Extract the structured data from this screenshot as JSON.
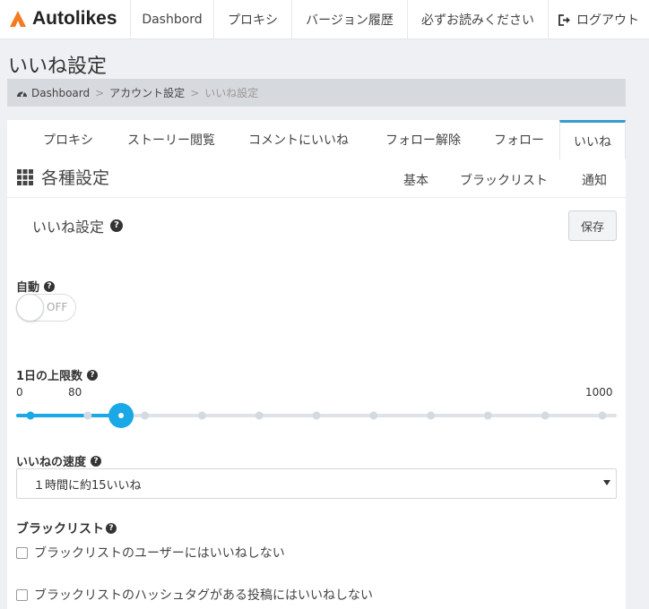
{
  "nav": {
    "brand": "Autolikes",
    "items": [
      "Dashbord",
      "プロキシ",
      "バージョン履歴",
      "必ずお読みください"
    ],
    "logout": "ログアウト"
  },
  "page": {
    "title": "いいね設定",
    "breadcrumb": [
      "Dashboard",
      "アカウント設定",
      "いいね設定"
    ]
  },
  "tabs": [
    "プロキシ",
    "ストーリー閲覧",
    "コメントにいいね",
    "フォロー解除",
    "フォロー",
    "いいね"
  ],
  "active_tab": "いいね",
  "section": {
    "title": "各種設定",
    "subtabs": [
      "基本",
      "ブラックリスト",
      "通知"
    ]
  },
  "form": {
    "title": "いいね設定",
    "help": "?",
    "save_label": "保存",
    "auto": {
      "label": "自動",
      "state": "OFF"
    },
    "daily_limit": {
      "label": "1日の上限数",
      "min": "0",
      "max": "1000",
      "value": "80"
    },
    "speed": {
      "label": "いいねの速度",
      "selected": "１時間に約15いいね"
    },
    "blacklist": {
      "label": "ブラックリスト",
      "options": [
        "ブラックリストのユーザーにはいいねしない",
        "ブラックリストのハッシュタグがある投稿にはいいねしない"
      ]
    }
  },
  "colors": {
    "accent": "#1aa8e6",
    "slider_track": "#dfe3e8",
    "tab_active_border": "#3a9ad0",
    "brand_orange": "#f47b20"
  },
  "icons": [
    "autolikes-logo-icon",
    "logout-icon",
    "dashboard-icon",
    "grid-icon",
    "question-circle-icon",
    "dropdown-caret-icon"
  ]
}
